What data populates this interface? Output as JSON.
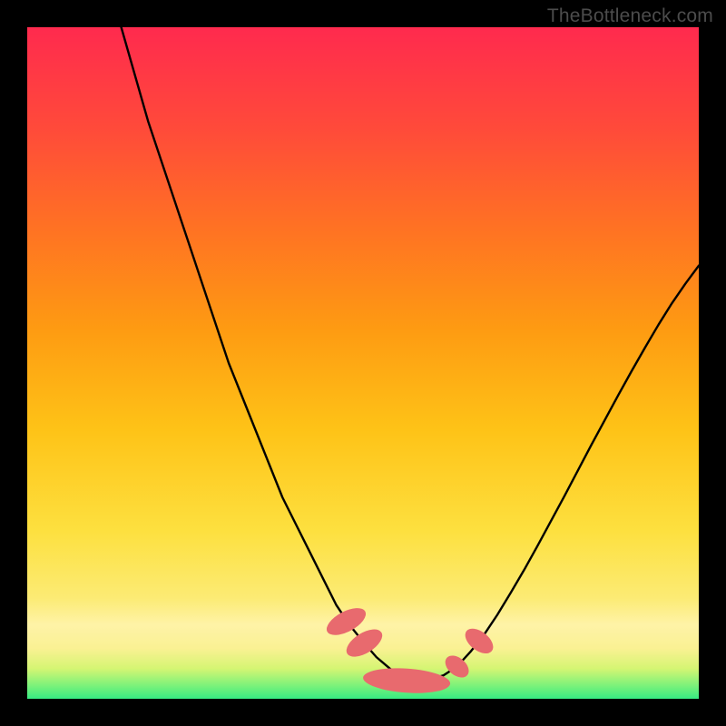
{
  "watermark": {
    "text": "TheBottleneck.com"
  },
  "chart_data": {
    "type": "line",
    "title": "",
    "xlabel": "",
    "ylabel": "",
    "xlim": [
      0,
      100
    ],
    "ylim": [
      0,
      100
    ],
    "series": [
      {
        "name": "left-curve",
        "x": [
          14,
          16,
          18,
          20,
          22,
          24,
          26,
          28,
          30,
          32,
          34,
          36,
          38,
          40,
          42,
          44,
          46,
          48,
          50,
          52,
          54,
          56,
          58
        ],
        "values": [
          100,
          93,
          86,
          80,
          74,
          68,
          62,
          56,
          50,
          45,
          40,
          35,
          30,
          26,
          22,
          18,
          14,
          11,
          8.5,
          6.2,
          4.5,
          3.2,
          2.5
        ]
      },
      {
        "name": "right-curve",
        "x": [
          58,
          60,
          62,
          64,
          66,
          68,
          70,
          72,
          74,
          76,
          78,
          80,
          82,
          84,
          86,
          88,
          90,
          92,
          94,
          96,
          98,
          100
        ],
        "values": [
          2.5,
          2.9,
          3.5,
          4.8,
          7.0,
          9.5,
          12.5,
          15.8,
          19.2,
          22.8,
          26.5,
          30.2,
          34.0,
          37.8,
          41.5,
          45.2,
          48.8,
          52.3,
          55.7,
          58.9,
          61.8,
          64.5
        ]
      }
    ],
    "markers": [
      {
        "name": "left-marker-1",
        "x": 47.5,
        "y": 11.5,
        "rx": 1.5,
        "ry": 3.2,
        "angle": 62
      },
      {
        "name": "left-marker-2",
        "x": 50.2,
        "y": 8.3,
        "rx": 1.5,
        "ry": 3.0,
        "angle": 58
      },
      {
        "name": "bottom-slug",
        "x": 56.5,
        "y": 2.7,
        "rx": 1.8,
        "ry": 6.5,
        "angle": 94
      },
      {
        "name": "right-marker-1",
        "x": 64.0,
        "y": 4.8,
        "rx": 1.3,
        "ry": 2.0,
        "angle": -50
      },
      {
        "name": "right-marker-2",
        "x": 67.3,
        "y": 8.6,
        "rx": 1.4,
        "ry": 2.4,
        "angle": -52
      }
    ],
    "gradient_stops": [
      {
        "offset": 0,
        "color": "#37eb82"
      },
      {
        "offset": 0.02,
        "color": "#7df27a"
      },
      {
        "offset": 0.045,
        "color": "#d5f573"
      },
      {
        "offset": 0.075,
        "color": "#faf193"
      },
      {
        "offset": 0.11,
        "color": "#fef3a7"
      },
      {
        "offset": 0.15,
        "color": "#fceb74"
      },
      {
        "offset": 0.25,
        "color": "#fde03f"
      },
      {
        "offset": 0.4,
        "color": "#fec317"
      },
      {
        "offset": 0.55,
        "color": "#fe9b12"
      },
      {
        "offset": 0.7,
        "color": "#ff7223"
      },
      {
        "offset": 0.85,
        "color": "#ff4a3a"
      },
      {
        "offset": 1.0,
        "color": "#ff2a4e"
      }
    ],
    "marker_color": "#e86a6e",
    "curve_color": "#000000",
    "curve_width": 2.4
  }
}
